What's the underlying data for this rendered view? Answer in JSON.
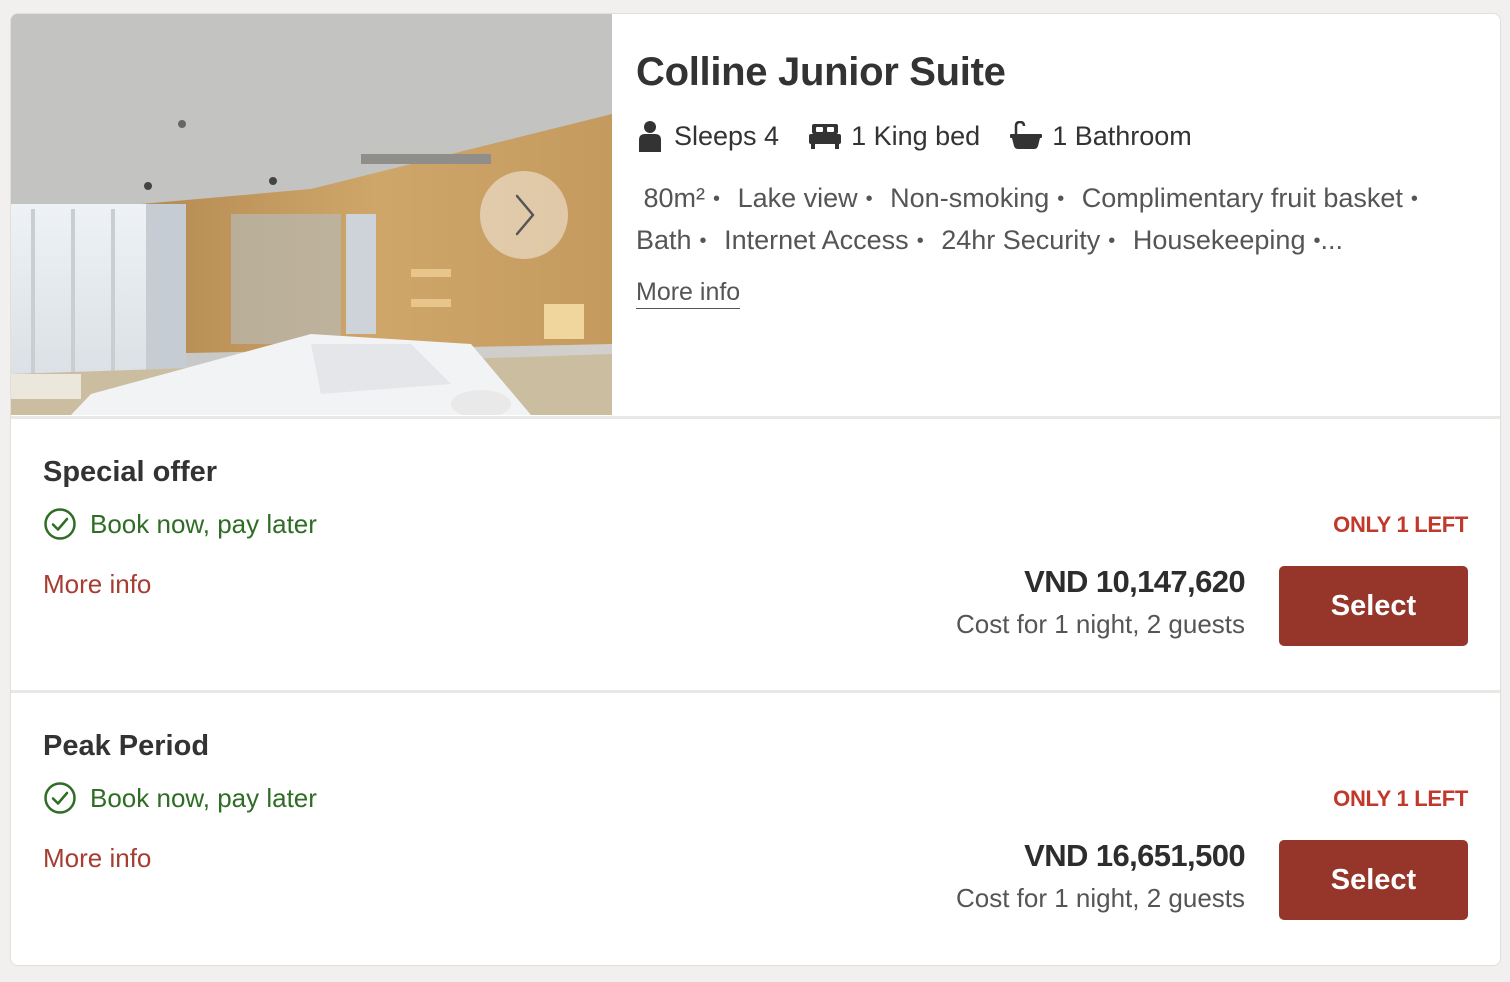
{
  "room": {
    "title": "Colline Junior Suite",
    "specs": [
      {
        "icon": "person-icon",
        "label": "Sleeps 4"
      },
      {
        "icon": "bed-icon",
        "label": "1 King bed"
      },
      {
        "icon": "bathtub-icon",
        "label": "1 Bathroom"
      }
    ],
    "amenities": [
      "80m²",
      "Lake view",
      "Non-smoking",
      "Complimentary fruit basket",
      "Bath",
      "Internet Access",
      "24hr Security",
      "Housekeeping"
    ],
    "amenities_more": "...",
    "more_info": "More info",
    "photo": {
      "next_icon": "chevron-right-icon"
    }
  },
  "rates": [
    {
      "title": "Special offer",
      "policy": "Book now, pay later",
      "more_info": "More info",
      "availability": "ONLY 1 LEFT",
      "price": "VND 10,147,620",
      "price_note": "Cost for 1 night, 2 guests",
      "select_label": "Select"
    },
    {
      "title": "Peak Period",
      "policy": "Book now, pay later",
      "more_info": "More info",
      "availability": "ONLY 1 LEFT",
      "price": "VND 16,651,500",
      "price_note": "Cost for 1 night, 2 guests",
      "select_label": "Select"
    }
  ],
  "colors": {
    "accent": "#96362b",
    "link_red": "#a63d32",
    "availability_red": "#c0392b",
    "policy_green": "#2f6d25"
  }
}
